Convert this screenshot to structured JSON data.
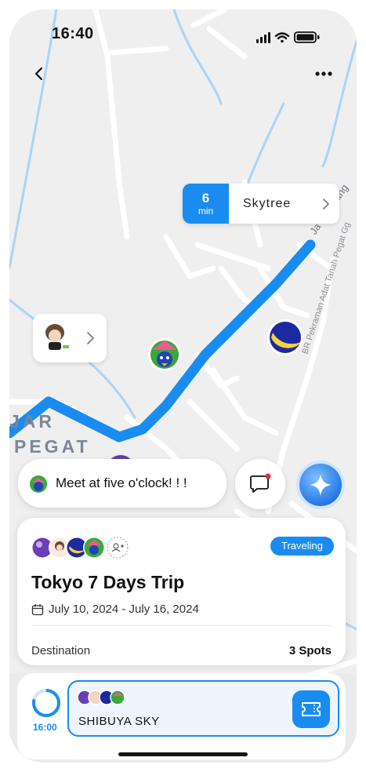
{
  "status_bar": {
    "time": "16:40"
  },
  "map": {
    "area_label_line1": "JAR",
    "area_label_line2": "PEGAT",
    "street_labels": [
      "BR Pekraman Adat Tanah Pegat Gg",
      "Ja Yeh Gang"
    ]
  },
  "eta": {
    "minutes": "6",
    "unit": "min",
    "destination": "Skytree"
  },
  "message": {
    "text": "Meet at five o'clock! ! !"
  },
  "trip": {
    "status": "Traveling",
    "title": "Tokyo 7 Days Trip",
    "dates": "July 10, 2024 - July 16, 2024",
    "destination_label": "Destination",
    "destination_value": "3 Spots"
  },
  "stop": {
    "time": "16:00",
    "name": "SHIBUYA SKY"
  },
  "colors": {
    "accent": "#1a8cf0",
    "route": "#1a8cf0",
    "map_bg": "#efefef",
    "road": "#ffffff",
    "river": "#a9d4f7"
  },
  "icons": [
    "back-icon",
    "more-icon",
    "chevron-right-icon",
    "chat-icon",
    "sparkle-icon",
    "calendar-icon",
    "add-friend-icon",
    "ticket-icon"
  ]
}
